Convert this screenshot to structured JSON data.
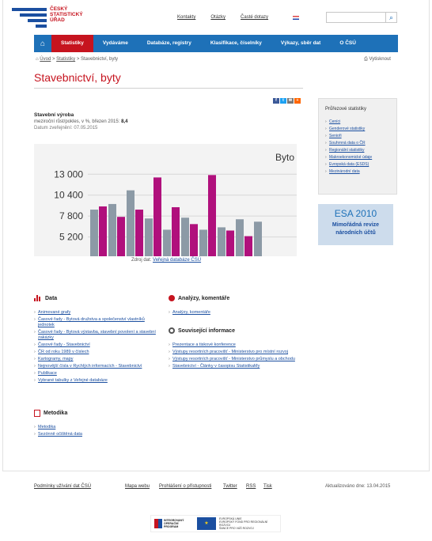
{
  "header": {
    "logo_lines": [
      "ČESKÝ",
      "STATISTICKÝ",
      "ÚŘAD"
    ],
    "top_links": [
      "Kontakty",
      "Otázky",
      "Časté dotazy"
    ],
    "search_icon": "search-icon"
  },
  "nav": {
    "home_icon": "home-icon",
    "items": [
      "Statistiky",
      "Vydáváme",
      "Databáze, registry",
      "Klasifikace, číselníky",
      "Výkazy, sběr dat",
      "O ČSÚ"
    ]
  },
  "breadcrumb": [
    "Úvod",
    "Statistiky",
    "Stavebnictví, byty"
  ],
  "print_label": "Vytisknout",
  "page_title": "Stavebnictví, byty",
  "stat": {
    "title": "Stavební výroba",
    "line_prefix": "meziroční růst/pokles, v %, březen 2015:",
    "line_value": "8,4",
    "date": "Datum zveřejnění: 07.05.2015"
  },
  "chart_data": {
    "type": "bar",
    "title": "Byto",
    "y_ticks": [
      "13 000",
      "10 400",
      "7 800",
      "5 200"
    ],
    "ylim": [
      2800,
      14800
    ],
    "series": [
      {
        "color": "#8c9aa6",
        "values": [
          8600,
          9300,
          11000,
          7500,
          6100,
          7600,
          6100,
          6400,
          7400,
          7100
        ]
      },
      {
        "color": "#b0107c",
        "values": [
          9000,
          7700,
          8600,
          12600,
          8900,
          6800,
          12900,
          6000,
          5300,
          null
        ]
      }
    ]
  },
  "source": {
    "prefix": "Zdroj dat:",
    "link": "Veřejná databáze ČSÚ"
  },
  "sidebar": {
    "title": "Průřezové statistiky",
    "items": [
      "Ceníci",
      "Genderové statistiky",
      "Senioři",
      "Souhrnná data o ČR",
      "Regionální statistiky",
      "Makroekonomické údaje",
      "Evropská data (ESDS)",
      "Mezinárodní data"
    ]
  },
  "esa": {
    "title": "ESA 2010",
    "line1": "Mimořádná revize",
    "line2": "národních účtů"
  },
  "sections": {
    "data": {
      "title": "Data",
      "items": [
        "Animované grafy",
        "Časové řady - Bytová družstva a společenství vlastníků jednotek",
        "Časové řady - Bytová výstavba, stavební povolení a stavební zakázky",
        "Časové řady - Stavebnictví",
        "ČR od roku 1989 v číslech",
        "Kartogramy, mapy",
        "Nejnovější čísla v Rychlých informacích - Stavebnictví",
        "Publikace",
        "Vybrané tabulky z Veřejné databáze"
      ]
    },
    "metodika": {
      "title": "Metodika",
      "items": [
        "Metodika",
        "Sezónně očištěná data"
      ]
    },
    "analyzy": {
      "title": "Analýzy, komentáře",
      "items": [
        "Analýzy, komentáře"
      ]
    },
    "souvisejici": {
      "title": "Související informace",
      "items": [
        "Prezentace a tiskové konference",
        "Výstupy resortních pracovišť - Ministerstvo pro místní rozvoj",
        "Výstupy resortních pracovišť - Ministerstvo průmyslu a obchodu",
        "Stavebnictví - Články v časopisu StatistikaMy"
      ]
    }
  },
  "footer": {
    "links": [
      "Podmínky užívání dat ČSÚ",
      "Mapa webu",
      "Prohlášení o přístupnosti",
      "Twitter",
      "RSS",
      "Tisk"
    ],
    "updated": "Aktualizováno dne: 13.04.2015",
    "op_text": [
      "INTEGROVANÝ",
      "OPERAČNÍ",
      "PROGRAM"
    ],
    "eu_text": [
      "EVROPSKÁ UNIE",
      "EVROPSKÝ FOND PRO REGIONÁLNÍ ROZVOJ",
      "ŠANCE PRO VÁŠ ROZVOJ"
    ]
  }
}
